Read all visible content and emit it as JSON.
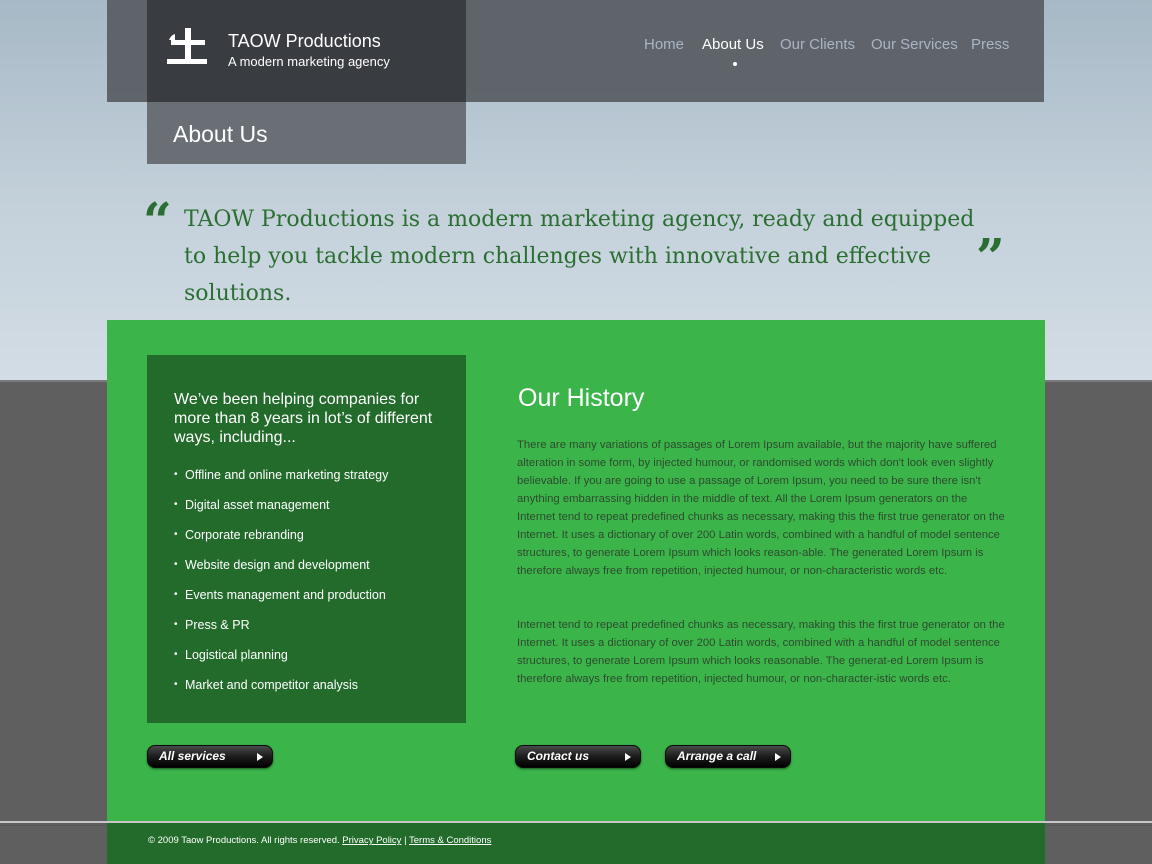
{
  "brand": {
    "name": "TAOW Productions",
    "tagline": "A modern marketing agency"
  },
  "nav": {
    "items": [
      {
        "label": "Home",
        "active": false
      },
      {
        "label": "About Us",
        "active": true
      },
      {
        "label": "Our Clients",
        "active": false
      },
      {
        "label": "Our Services",
        "active": false
      },
      {
        "label": "Press",
        "active": false
      }
    ]
  },
  "page": {
    "title": "About Us"
  },
  "quote": {
    "open_mark": "“",
    "close_mark": "”",
    "text": "TAOW Productions is a modern marketing agency, ready and equipped to help you tackle modern challenges with innovative and effective solutions."
  },
  "services": {
    "intro": "We’ve been helping companies for more than 8 years in lot’s of different ways, including...",
    "items": [
      "Offline and online marketing strategy",
      "Digital asset management",
      "Corporate rebranding",
      "Website design and development",
      "Events management and production",
      "Press & PR",
      "Logistical planning",
      "Market and competitor analysis"
    ]
  },
  "history": {
    "title": "Our History",
    "paragraphs": [
      "There are many variations of passages of Lorem Ipsum available, but the majority have suffered alteration in some form, by injected humour, or randomised words which don't look even slightly believable. If you are going to use a passage of Lorem Ipsum, you need to be sure there isn't anything embarrassing hidden in the middle of text. All the Lorem Ipsum generators on the Internet tend to repeat predefined chunks as necessary, making this the first true generator on the Internet. It uses a dictionary of over 200 Latin words, combined with a handful of model sentence structures, to generate Lorem Ipsum which looks reason-able. The generated Lorem Ipsum is therefore always free from repetition, injected humour, or non-characteristic words etc.",
      "Internet tend to repeat predefined chunks as necessary, making this the first true generator on the Internet. It uses a dictionary of over 200 Latin words, combined with a handful of model sentence structures, to generate Lorem Ipsum which looks reasonable. The generat-ed Lorem Ipsum is therefore always free from repetition, injected humour, or non-character-istic words etc."
    ]
  },
  "buttons": {
    "all_services": "All services",
    "contact_us": "Contact us",
    "arrange_call": "Arrange a call"
  },
  "footer": {
    "copyright": "© 2009 Taow Productions. All rights reserved.",
    "privacy": "Privacy Policy",
    "separator": "|",
    "terms": "Terms & Conditions"
  },
  "colors": {
    "header_bg": "#585c62",
    "logo_bg": "#393c41",
    "main_green": "#3bb54a",
    "dark_green": "#226b2b",
    "quote_green": "#2a6e32"
  },
  "icons": {
    "logo": "taow-logo-icon",
    "button_arrow": "arrow-right-icon"
  }
}
